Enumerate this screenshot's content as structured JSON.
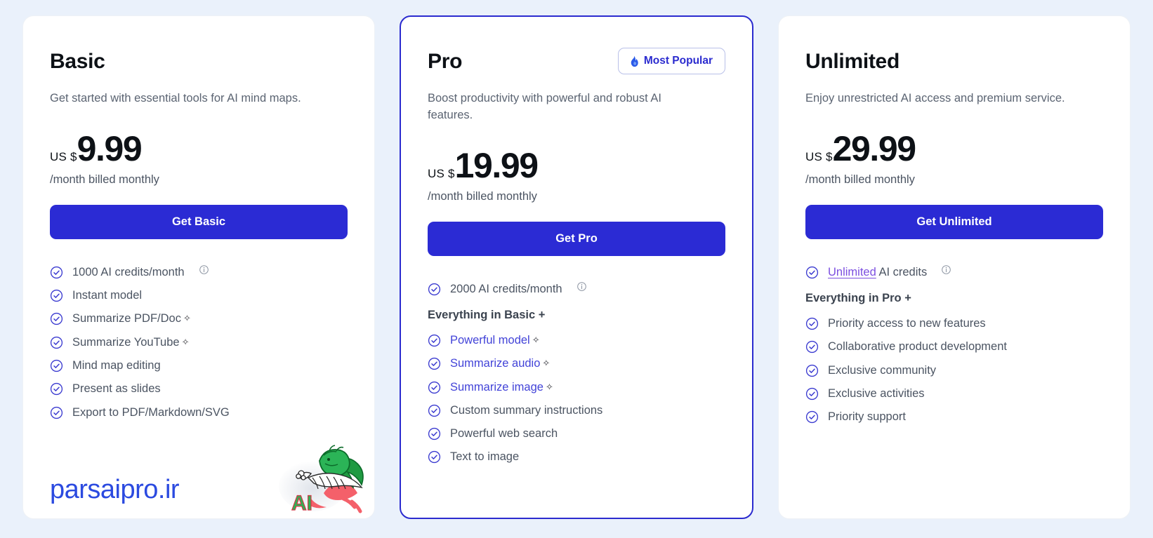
{
  "theme": {
    "page_background": "#eaf1fb",
    "card_background": "#ffffff",
    "accent": "#2b2bd4",
    "featured_border": "#2b2bcf",
    "link_accent": "#4243d8",
    "highlight_purple": "#7b4ee0",
    "body_text": "#4b5462",
    "heading_text": "#0d1116"
  },
  "icons": {
    "check": "check-circle-icon",
    "info": "info-circle-icon",
    "flame": "flame-icon",
    "sparkle": "sparkle-icon"
  },
  "watermark": {
    "text": "parsaipro.ir",
    "logo_label": "AI",
    "color": "#2b4ae0"
  },
  "plans": [
    {
      "id": "basic",
      "name": "Basic",
      "tagline": "Get started with essential tools for AI mind maps.",
      "currency": "US $",
      "amount": "9.99",
      "billing_note": "/month billed monthly",
      "cta_label": "Get Basic",
      "featured": false,
      "badge": null,
      "group_heading": null,
      "features": [
        {
          "label": "1000 AI credits/month",
          "accent": false,
          "sparkle": false,
          "info": true
        },
        {
          "label": "Instant model",
          "accent": false,
          "sparkle": false,
          "info": false
        },
        {
          "label": "Summarize PDF/Doc",
          "accent": false,
          "sparkle": true,
          "info": false
        },
        {
          "label": "Summarize YouTube",
          "accent": false,
          "sparkle": true,
          "info": false
        },
        {
          "label": "Mind map editing",
          "accent": false,
          "sparkle": false,
          "info": false
        },
        {
          "label": "Present as slides",
          "accent": false,
          "sparkle": false,
          "info": false
        },
        {
          "label": "Export to PDF/Markdown/SVG",
          "accent": false,
          "sparkle": false,
          "info": false
        }
      ],
      "group_features": []
    },
    {
      "id": "pro",
      "name": "Pro",
      "tagline": "Boost productivity with powerful and robust AI features.",
      "currency": "US $",
      "amount": "19.99",
      "billing_note": "/month billed monthly",
      "cta_label": "Get Pro",
      "featured": true,
      "badge": "Most Popular",
      "group_heading": "Everything in Basic +",
      "features": [
        {
          "label": "2000 AI credits/month",
          "accent": false,
          "sparkle": false,
          "info": true
        }
      ],
      "group_features": [
        {
          "label": "Powerful model",
          "accent": true,
          "sparkle": true,
          "info": false
        },
        {
          "label": "Summarize audio",
          "accent": true,
          "sparkle": true,
          "info": false
        },
        {
          "label": "Summarize image",
          "accent": true,
          "sparkle": true,
          "info": false
        },
        {
          "label": "Custom summary instructions",
          "accent": false,
          "sparkle": false,
          "info": false
        },
        {
          "label": "Powerful web search",
          "accent": false,
          "sparkle": false,
          "info": false
        },
        {
          "label": "Text to image",
          "accent": false,
          "sparkle": false,
          "info": false
        }
      ]
    },
    {
      "id": "unlimited",
      "name": "Unlimited",
      "tagline": "Enjoy unrestricted AI access and premium service.",
      "currency": "US $",
      "amount": "29.99",
      "billing_note": "/month billed monthly",
      "cta_label": "Get Unlimited",
      "featured": false,
      "badge": null,
      "group_heading": "Everything in Pro +",
      "features": [
        {
          "label": "AI credits",
          "highlight_prefix": "Unlimited",
          "accent": false,
          "sparkle": false,
          "info": true
        }
      ],
      "group_features": [
        {
          "label": "Priority access to new features",
          "accent": false,
          "sparkle": false,
          "info": false
        },
        {
          "label": "Collaborative product development",
          "accent": false,
          "sparkle": false,
          "info": false
        },
        {
          "label": "Exclusive community",
          "accent": false,
          "sparkle": false,
          "info": false
        },
        {
          "label": "Exclusive activities",
          "accent": false,
          "sparkle": false,
          "info": false
        },
        {
          "label": "Priority support",
          "accent": false,
          "sparkle": false,
          "info": false
        }
      ]
    }
  ]
}
